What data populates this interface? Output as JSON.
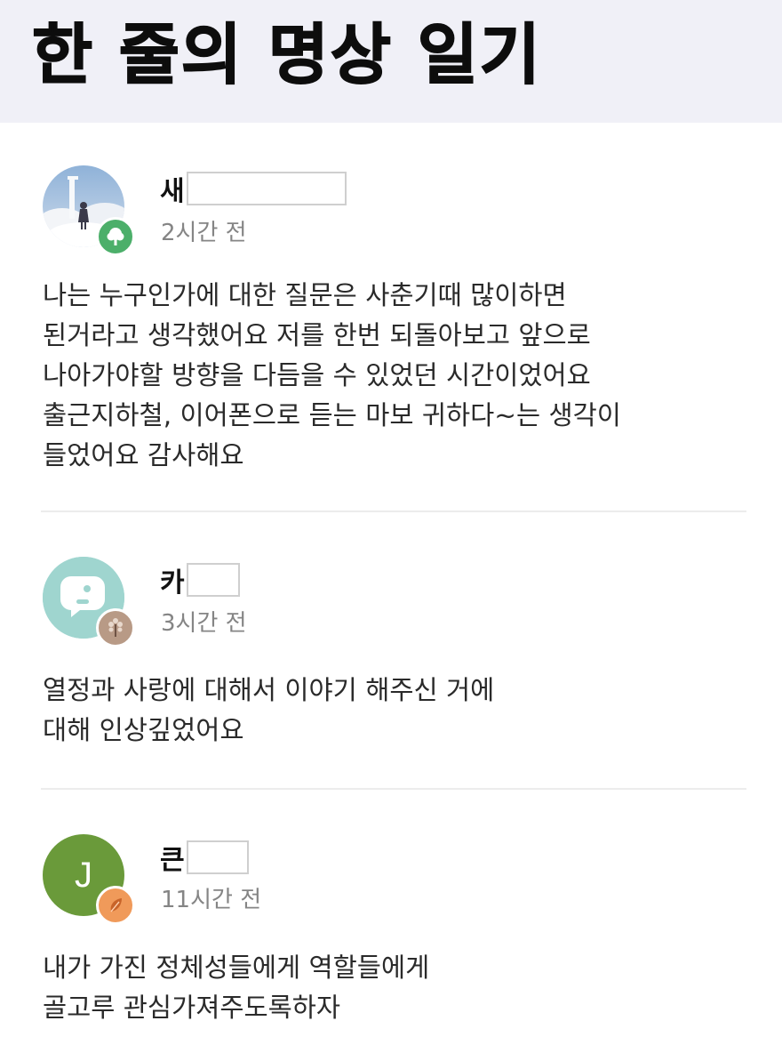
{
  "app": {
    "title": "한 줄의 명상 일기"
  },
  "comments": [
    {
      "author": "새",
      "time": "2시간 전",
      "lines": [
        "나는 누구인가에 대한 질문은 사춘기때 많이하면",
        "된거라고 생각했어요 저를 한번 되돌아보고 앞으로",
        "나아가야할 방향을 다듬을 수 있었던 시간이었어요",
        "출근지하철, 이어폰으로 듣는 마보 귀하다~는 생각이",
        "들었어요 감사해요"
      ],
      "avatar_icon": "photo-avatar-icon",
      "badge_icon": "tree-badge-icon",
      "badge_color": "#4caf6a"
    },
    {
      "author": "카",
      "time": "3시간 전",
      "lines": [
        "열정과 사랑에 대해서 이야기 해주신 거에",
        "대해 인상깊었어요"
      ],
      "avatar_icon": "face-avatar-icon",
      "avatar_color": "#9fd5cf",
      "badge_icon": "sapling-badge-icon",
      "badge_color": "#b89a86"
    },
    {
      "author": "큰",
      "time": "11시간 전",
      "lines": [
        "내가 가진 정체성들에게 역할들에게",
        "골고루 관심가져주도록하자"
      ],
      "avatar_letter": "J",
      "avatar_color": "#6a9a3a",
      "badge_icon": "seed-badge-icon",
      "badge_color": "#f09a5a"
    }
  ]
}
